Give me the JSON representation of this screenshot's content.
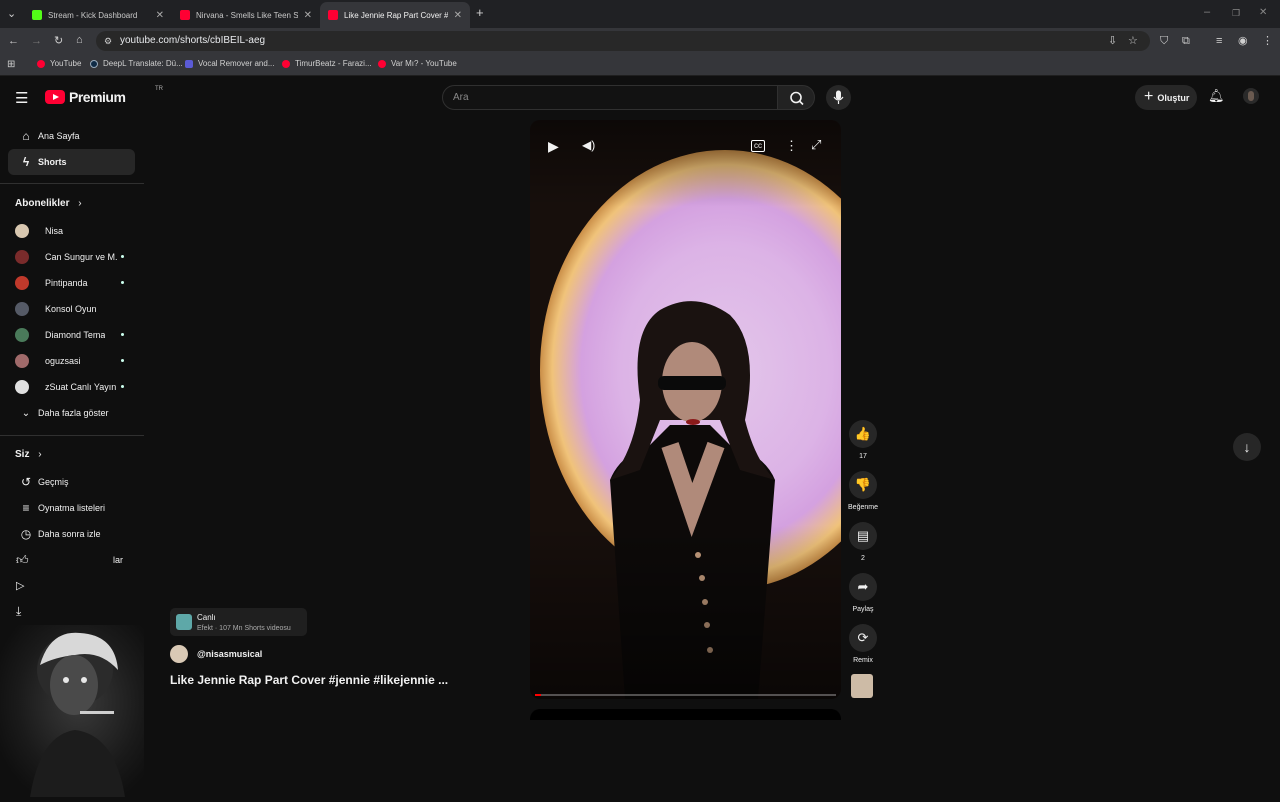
{
  "browser": {
    "tabs": [
      {
        "title": "Stream - Kick Dashboard",
        "color": "#53fc18"
      },
      {
        "title": "Nirvana - Smells Like Teen Spirit",
        "color": "#ff0033"
      },
      {
        "title": "Like Jennie Rap Part Cover #jennie",
        "color": "#ff0033"
      }
    ],
    "new_tab": "+",
    "url": "youtube.com/shorts/cbIBEIL-aeg",
    "bookmarks": [
      {
        "label": "YouTube",
        "color": "#ff0033"
      },
      {
        "label": "DeepL Translate: Dü...",
        "color": "#0f2b46"
      },
      {
        "label": "Vocal Remover and...",
        "color": "#5b5bd6"
      },
      {
        "label": "TimurBeatz - Farazi...",
        "color": "#ff0033"
      },
      {
        "label": "Var Mı? - YouTube",
        "color": "#ff0033"
      }
    ]
  },
  "header": {
    "logo": "Premium",
    "country": "TR",
    "search_placeholder": "Ara",
    "create_label": "Oluştur",
    "create_icon": "+"
  },
  "sidebar": {
    "main": [
      {
        "label": "Ana Sayfa",
        "icon": "⌂"
      },
      {
        "label": "Shorts",
        "icon": "ϟ"
      }
    ],
    "subs_title": "Abonelikler",
    "subs": [
      {
        "label": "Nisa",
        "color": "#d8c7b0"
      },
      {
        "label": "Can Sungur ve M...",
        "color": "#7a2b2b"
      },
      {
        "label": "Pintipanda",
        "color": "#c0392b"
      },
      {
        "label": "Konsol Oyun",
        "color": "#555a66"
      },
      {
        "label": "Diamond Tema",
        "color": "#4a7a5a"
      },
      {
        "label": "oguzsasi",
        "color": "#a06a6a"
      },
      {
        "label": "zSuat Canlı Yayın",
        "color": "#e0e0e0"
      }
    ],
    "show_more": "Daha fazla göster",
    "you_title": "Siz",
    "you": [
      {
        "label": "Geçmiş",
        "icon": "↺"
      },
      {
        "label": "Oynatma listeleri",
        "icon": "≡"
      },
      {
        "label": "Daha sonra izle",
        "icon": "◷"
      }
    ],
    "partial": "lar"
  },
  "short": {
    "effect_title": "Canlı",
    "effect_sub": "Efekt · 107 Mn Shorts videosu",
    "channel": "@nisasmusical",
    "title": "Like Jennie Rap Part Cover #jennie #likejennie ...",
    "progress": 0.02,
    "actions": [
      {
        "name": "like",
        "icon": "👍",
        "label": "17"
      },
      {
        "name": "dislike",
        "icon": "👎",
        "label": "Beğenme"
      },
      {
        "name": "comments",
        "icon": "▤",
        "label": "2"
      },
      {
        "name": "share",
        "icon": "➦",
        "label": "Paylaş"
      },
      {
        "name": "remix",
        "icon": "⟳",
        "label": "Remix"
      }
    ]
  },
  "colors": {
    "brand": "#ff0033",
    "bg": "#0f0f0f",
    "chip": "#272727"
  }
}
